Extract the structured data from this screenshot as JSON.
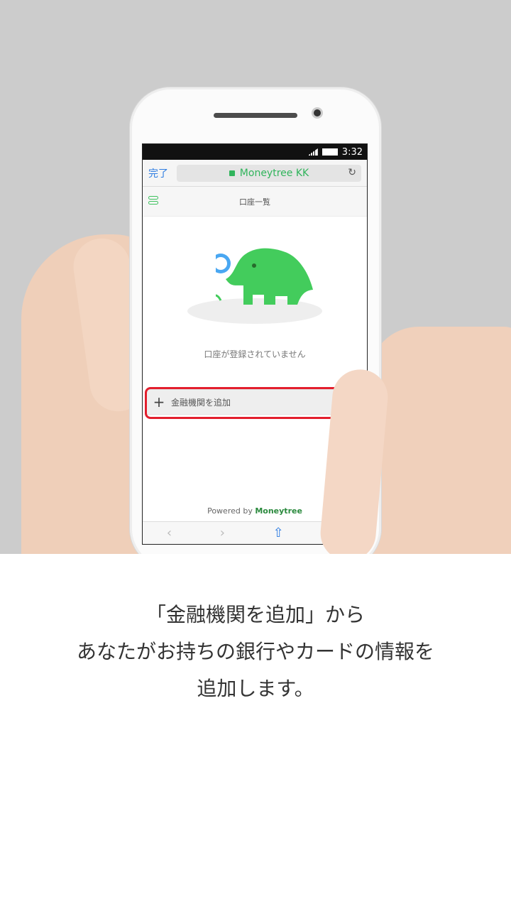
{
  "status": {
    "time": "3:32"
  },
  "browser": {
    "done_label": "完了",
    "url_title": "Moneytree KK",
    "reload_icon": "reload-icon"
  },
  "app": {
    "header_title": "口座一覧",
    "empty_message": "口座が登録されていません",
    "add_button_label": "金融機関を追加",
    "powered_by_prefix": "Powered by",
    "brand_name": "Moneytree"
  },
  "caption": {
    "line1": "「金融機関を追加」から",
    "line2": "あなたがお持ちの銀行やカードの情報を",
    "line3": "追加します。"
  },
  "colors": {
    "accent": "#31b45c",
    "highlight": "#e31e2d",
    "link": "#2f7de1"
  }
}
